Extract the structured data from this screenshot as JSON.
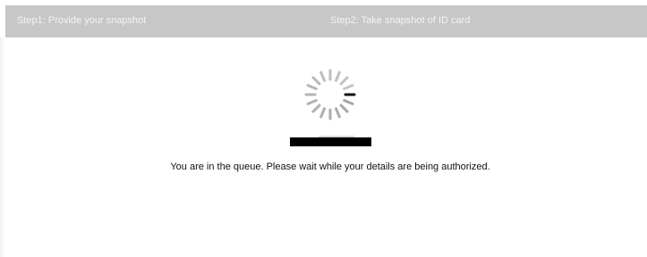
{
  "steps": [
    {
      "label": "Step1: Provide your snapshot",
      "active": false
    },
    {
      "label": "Step2: Take snapshot of ID card",
      "active": false
    }
  ],
  "status": {
    "message": "You are in the queue. Please wait while your details are being authorized.",
    "indicator": "loading-spinner-icon",
    "spinner_color": "#9a9a9a",
    "spinner_leading_color": "#111111"
  },
  "colors": {
    "step_bar_bg": "#c7c7c7",
    "step_text": "#f4f4f4",
    "background": "#ffffff"
  }
}
